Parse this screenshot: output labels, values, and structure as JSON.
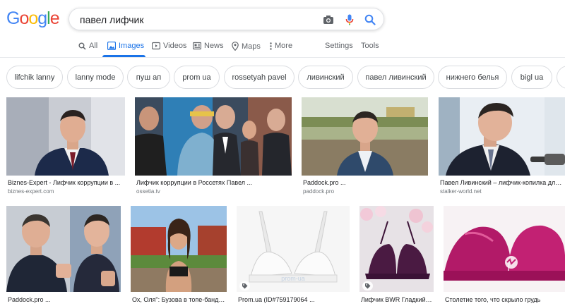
{
  "logo": {
    "letters": [
      "G",
      "o",
      "o",
      "g",
      "l",
      "e"
    ],
    "colors": [
      "#4285F4",
      "#EA4335",
      "#FBBC05",
      "#4285F4",
      "#34A853",
      "#EA4335"
    ]
  },
  "search": {
    "query": "павел лифчик",
    "icons": [
      "camera-icon",
      "microphone-icon",
      "search-icon"
    ]
  },
  "tabs": [
    {
      "label": "All",
      "icon": "search-icon",
      "active": false
    },
    {
      "label": "Images",
      "icon": "image-icon",
      "active": true
    },
    {
      "label": "Videos",
      "icon": "play-icon",
      "active": false
    },
    {
      "label": "News",
      "icon": "newspaper-icon",
      "active": false
    },
    {
      "label": "Maps",
      "icon": "map-pin-icon",
      "active": false
    },
    {
      "label": "More",
      "icon": "kebab-icon",
      "active": false
    },
    {
      "label": "Settings",
      "active": false
    },
    {
      "label": "Tools",
      "active": false
    }
  ],
  "chips": [
    "lifchik lanny",
    "lanny mode",
    "пуш ап",
    "prom ua",
    "rossetyah pavel",
    "ливинский",
    "павел ливинский",
    "нижнего белья",
    "bigl ua"
  ],
  "results": [
    {
      "caption": "Biznes-Expert - Лифчик коррупции в ...",
      "source": "biznes-expert.com"
    },
    {
      "caption": "Лифчик коррупции в Россетях Павел ...",
      "source": "ossetia.tv"
    },
    {
      "caption": "Paddock.pro ...",
      "source": "paddock.pro"
    },
    {
      "caption": "Павел Ливинский – лифчик-копилка для ...",
      "source": "stalker-world.net"
    },
    {
      "caption": "Paddock.pro ...",
      "source": ""
    },
    {
      "caption": "Ох, Оля\": Бузова в топе-бандо ...",
      "source": ""
    },
    {
      "caption": "Prom.ua (ID#759179064 ...",
      "source": ""
    },
    {
      "caption": "Лифчик BWR Гладкий ...",
      "source": ""
    },
    {
      "caption": "Столетие того, что скрыло грудь",
      "source": ""
    }
  ],
  "watermark": "prom-ua",
  "colors": {
    "accent": "#1a73e8",
    "muted": "#5f6368",
    "border": "#dadce0"
  }
}
